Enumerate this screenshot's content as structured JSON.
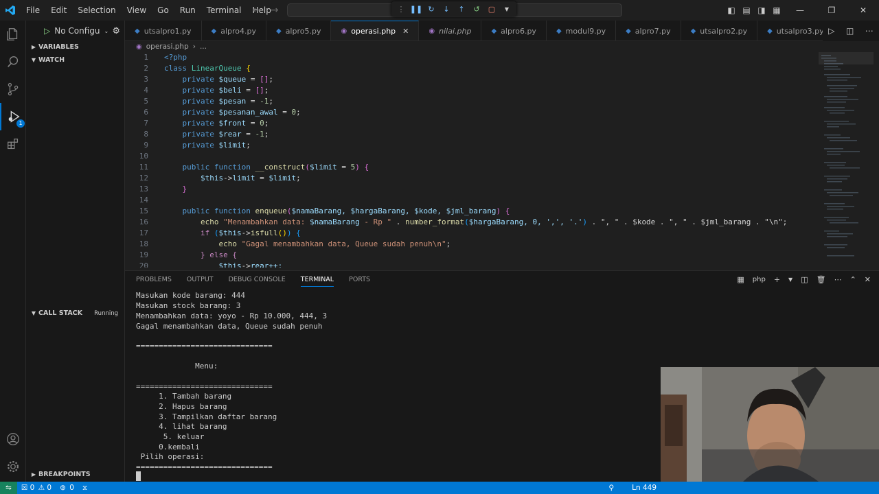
{
  "menu": [
    "File",
    "Edit",
    "Selection",
    "View",
    "Go",
    "Run",
    "Terminal",
    "Help"
  ],
  "sidebar": {
    "run_config": "No Configu",
    "variables": "VARIABLES",
    "watch": "WATCH",
    "call_stack": "CALL STACK",
    "call_stack_status": "Running",
    "breakpoints": "BREAKPOINTS"
  },
  "activity_badge": "1",
  "tabs": [
    {
      "label": "utsalpro1.py",
      "icon": "py"
    },
    {
      "label": "alpro4.py",
      "icon": "py"
    },
    {
      "label": "alpro5.py",
      "icon": "py"
    },
    {
      "label": "operasi.php",
      "icon": "php"
    },
    {
      "label": "nilai.php",
      "icon": "php"
    },
    {
      "label": "alpro6.py",
      "icon": "py"
    },
    {
      "label": "modul9.py",
      "icon": "py"
    },
    {
      "label": "alpro7.py",
      "icon": "py"
    },
    {
      "label": "utsalpro2.py",
      "icon": "py"
    },
    {
      "label": "utsalpro3.py",
      "icon": "py"
    }
  ],
  "breadcrumb": {
    "file": "operasi.php",
    "rest": "..."
  },
  "line_numbers": [
    "1",
    "2",
    "3",
    "4",
    "5",
    "6",
    "7",
    "8",
    "9",
    "10",
    "11",
    "12",
    "13",
    "14",
    "15",
    "16",
    "17",
    "18",
    "19",
    "20"
  ],
  "code": {
    "l1": "<?php",
    "l2_kw": "class",
    "l2_cls": "LinearQueue",
    "l3_kw": "private",
    "l3_var": "$queue",
    "l4_kw": "private",
    "l4_var": "$beli",
    "l5_kw": "private",
    "l5_var": "$pesan",
    "l5_num": "-1",
    "l6_kw": "private",
    "l6_var": "$pesanan_awal",
    "l6_num": "0",
    "l7_kw": "private",
    "l7_var": "$front",
    "l7_num": "0",
    "l8_kw": "private",
    "l8_var": "$rear",
    "l8_num": "-1",
    "l9_kw": "private",
    "l9_var": "$limit",
    "l11_kw": "public function",
    "l11_fn": "__construct",
    "l11_var": "$limit",
    "l11_num": "5",
    "l12_var": "$this",
    "l12_prop": "limit",
    "l12_var2": "$limit",
    "l15_kw": "public function",
    "l15_fn": "enqueue",
    "l15_params": "$namaBarang, $hargaBarang, $kode, $jml_barang",
    "l16_fn": "echo",
    "l16_str1": "\"Menambahkan data: ",
    "l16_var1": "$namaBarang",
    "l16_str2": " - Rp \"",
    "l16_fn2": "number_format",
    "l16_args": "$hargaBarang, 0, ',', '.'",
    "l16_rest": " . \", \" . $kode . \", \" . $jml_barang . \"\\n\";",
    "l17_ctl": "if",
    "l17_var": "$this",
    "l17_fn": "isfull",
    "l18_fn": "echo",
    "l18_str": "\"Gagal menambahkan data, Queue sudah penuh\\n\"",
    "l19_ctl": "} else {",
    "l20_var": "$this",
    "l20_prop": "rear++;"
  },
  "panel_tabs": [
    "PROBLEMS",
    "OUTPUT",
    "DEBUG CONSOLE",
    "TERMINAL",
    "PORTS"
  ],
  "terminal_shell": "php",
  "terminal": [
    "Masukan kode barang: 444",
    "Masukan stock barang: 3",
    "Menambahkan data: yoyo - Rp 10.000, 444, 3",
    "Gagal menambahkan data, Queue sudah penuh",
    "",
    "==============================",
    "",
    "             Menu:",
    "",
    "==============================",
    "     1. Tambah barang",
    "     2. Hapus barang",
    "     3. Tampilkan daftar barang",
    "     4. lihat barang",
    "      5. keluar",
    "     0.kembali",
    " Pilih operasi:",
    "=============================="
  ],
  "status": {
    "errors": "0",
    "warnings": "0",
    "ports": "0",
    "position": "Ln 449"
  },
  "colors": {
    "accent": "#0078d4",
    "statusbar": "#0078d4"
  }
}
